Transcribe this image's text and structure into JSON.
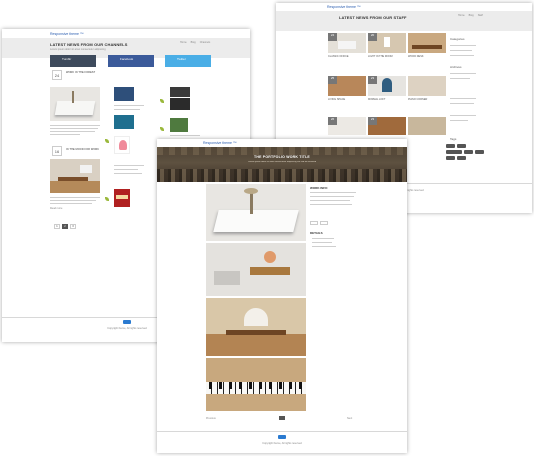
{
  "brand": {
    "logo_text": "Responsive theme ™"
  },
  "channels_page": {
    "title": "LATEST NEWS FROM OUR CHANNELS",
    "subtitle": "Lorem ipsum dolor sit amet consectetur adipiscing",
    "breadcrumb": [
      "Home",
      "Blog",
      "Channels"
    ],
    "social_boxes": [
      {
        "name": "Tumblr",
        "color": "#3d4a5c"
      },
      {
        "name": "Facebook",
        "color": "#3b5a9a"
      },
      {
        "name": "Twitter",
        "color": "#4aaee6"
      }
    ],
    "post1": {
      "day": "24",
      "title": "WORK IN THE FOREST"
    },
    "post2": {
      "day": "16",
      "title": "IN THE MOOD FOR WORK"
    },
    "read_more": "Read more",
    "pagination": [
      "1",
      "2",
      "3"
    ],
    "footer": "Copyright theme, All rights reserved"
  },
  "staff_page": {
    "title": "LATEST NEWS FROM OUR STAFF",
    "breadcrumb": [
      "Home",
      "Blog",
      "Staff"
    ],
    "days": [
      "24",
      "20",
      "25",
      "23",
      "26",
      "23"
    ],
    "post_titles": [
      "CLASSIC OFFICE",
      "LIGHT IN THE ROOM",
      "WOOD DESK",
      "LIVING SPACE",
      "MINIMAL LOFT",
      "PIANO CORNER"
    ],
    "sidebar_headings": [
      "Categories",
      "Archives",
      "Tags"
    ],
    "footer": "Copyright theme, All rights reserved"
  },
  "portfolio_page": {
    "banner_title": "THE PORTFOLIO WORK TITLE",
    "banner_subtitle": "Lorem ipsum dolor sit amet consectetur adipiscing elit sed do eiusmod",
    "work_info_heading": "WORK INFO",
    "details_heading": "DETAILS",
    "prev_label": "Previous",
    "next_label": "Next",
    "footer": "Copyright theme, All rights reserved"
  }
}
